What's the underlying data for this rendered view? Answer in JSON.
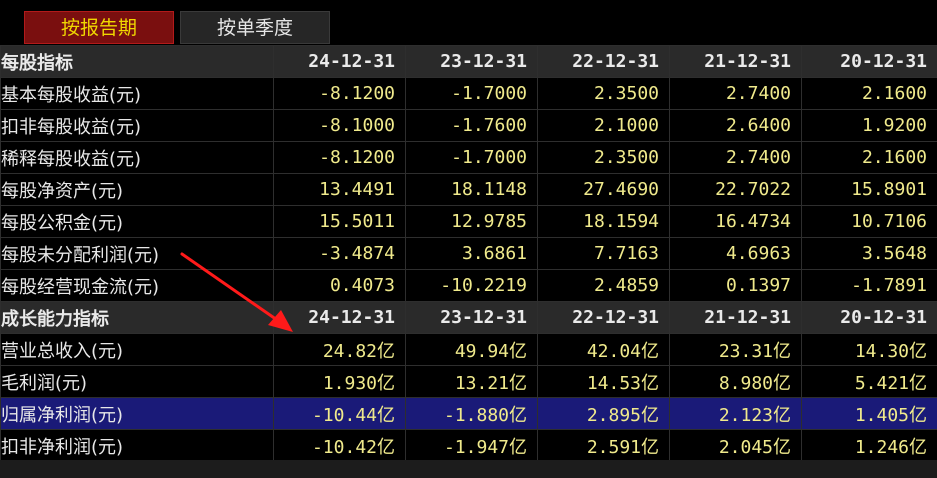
{
  "tabs": [
    {
      "label": "按报告期",
      "active": true
    },
    {
      "label": "按单季度",
      "active": false
    }
  ],
  "sections": {
    "per_share": {
      "title": "每股指标",
      "periods": [
        "24-12-31",
        "23-12-31",
        "22-12-31",
        "21-12-31",
        "20-12-31"
      ],
      "rows": [
        {
          "label": "基本每股收益(元)",
          "values": [
            "-8.1200",
            "-1.7000",
            "2.3500",
            "2.7400",
            "2.1600"
          ]
        },
        {
          "label": "扣非每股收益(元)",
          "values": [
            "-8.1000",
            "-1.7600",
            "2.1000",
            "2.6400",
            "1.9200"
          ]
        },
        {
          "label": "稀释每股收益(元)",
          "values": [
            "-8.1200",
            "-1.7000",
            "2.3500",
            "2.7400",
            "2.1600"
          ]
        },
        {
          "label": "每股净资产(元)",
          "values": [
            "13.4491",
            "18.1148",
            "27.4690",
            "22.7022",
            "15.8901"
          ]
        },
        {
          "label": "每股公积金(元)",
          "values": [
            "15.5011",
            "12.9785",
            "18.1594",
            "16.4734",
            "10.7106"
          ]
        },
        {
          "label": "每股未分配利润(元)",
          "values": [
            "-3.4874",
            "3.6861",
            "7.7163",
            "4.6963",
            "3.5648"
          ]
        },
        {
          "label": "每股经营现金流(元)",
          "values": [
            "0.4073",
            "-10.2219",
            "2.4859",
            "0.1397",
            "-1.7891"
          ]
        }
      ]
    },
    "growth": {
      "title": "成长能力指标",
      "periods": [
        "24-12-31",
        "23-12-31",
        "22-12-31",
        "21-12-31",
        "20-12-31"
      ],
      "rows": [
        {
          "label": "营业总收入(元)",
          "values": [
            "24.82亿",
            "49.94亿",
            "42.04亿",
            "23.31亿",
            "14.30亿"
          ]
        },
        {
          "label": "毛利润(元)",
          "values": [
            "1.930亿",
            "13.21亿",
            "14.53亿",
            "8.980亿",
            "5.421亿"
          ]
        },
        {
          "label": "归属净利润(元)",
          "values": [
            "-10.44亿",
            "-1.880亿",
            "2.895亿",
            "2.123亿",
            "1.405亿"
          ],
          "highlighted": true
        },
        {
          "label": "扣非净利润(元)",
          "values": [
            "-10.42亿",
            "-1.947亿",
            "2.591亿",
            "2.045亿",
            "1.246亿"
          ]
        }
      ]
    }
  }
}
